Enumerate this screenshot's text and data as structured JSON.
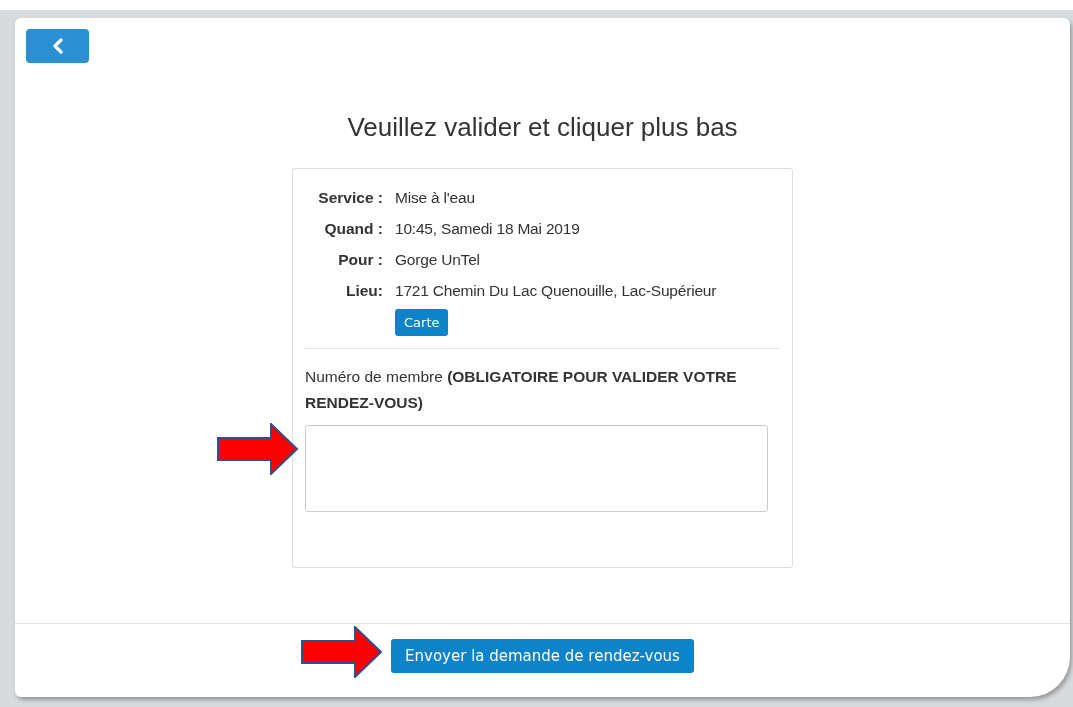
{
  "title": "Veuillez valider et cliquer plus bas",
  "details": [
    {
      "label": "Service :",
      "value": "Mise à l'eau"
    },
    {
      "label": "Quand :",
      "value": "10:45, Samedi 18 Mai 2019"
    },
    {
      "label": "Pour :",
      "value": "Gorge UnTel"
    },
    {
      "label": "Lieu:",
      "value": "1721 Chemin Du Lac Quenouille, Lac-Supérieur"
    }
  ],
  "map_button": "Carte",
  "member_field": {
    "label": "Numéro de membre **(OBLIGATOIRE POUR VALIDER VOTRE RENDEZ-VOUS)**"
  },
  "submit_button": "Envoyer la demande de rendez-vous"
}
